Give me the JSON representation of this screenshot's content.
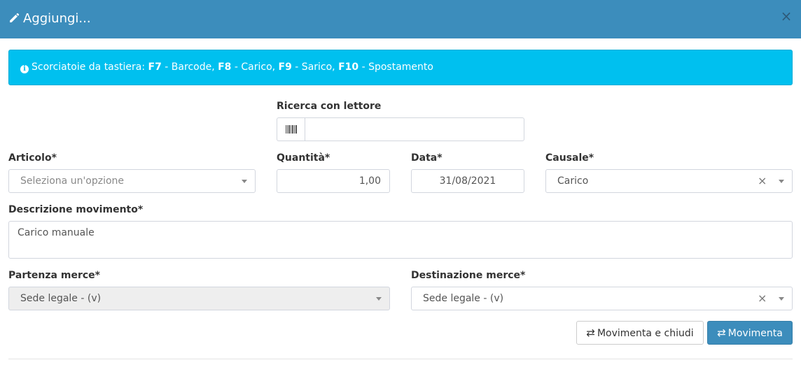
{
  "dialog": {
    "title": "Aggiungi...",
    "title_icon": "pencil-icon",
    "close_icon": "close-icon",
    "close_glyph": "×"
  },
  "alert": {
    "icon": "info-icon",
    "icon_glyph": "i",
    "prefix": "Scorciatoie da tastiera: ",
    "shortcuts": [
      {
        "key": "F7",
        "label": " - Barcode, "
      },
      {
        "key": "F8",
        "label": " - Carico, "
      },
      {
        "key": "F9",
        "label": " - Sarico, "
      },
      {
        "key": "F10",
        "label": " - Spostamento"
      }
    ]
  },
  "form": {
    "barcode": {
      "label": "Ricerca con lettore",
      "icon": "barcode-icon",
      "value": ""
    },
    "articolo": {
      "label": "Articolo*",
      "placeholder": "Seleziona un'opzione"
    },
    "quantita": {
      "label": "Quantità*",
      "value": "1,00"
    },
    "data": {
      "label": "Data*",
      "value": "31/08/2021"
    },
    "causale": {
      "label": "Causale*",
      "value": "Carico",
      "clear_glyph": "×"
    },
    "descrizione": {
      "label": "Descrizione movimento*",
      "value": "Carico manuale"
    },
    "partenza": {
      "label": "Partenza merce*",
      "value": "Sede legale - (v)"
    },
    "destinazione": {
      "label": "Destinazione merce*",
      "value": "Sede legale - (v)",
      "clear_glyph": "×"
    }
  },
  "buttons": {
    "icon": "exchange-icon",
    "icon_glyph": "⇄",
    "movimenta_chiudi": "Movimenta e chiudi",
    "movimenta": "Movimenta"
  },
  "colors": {
    "header": "#3c8dbc",
    "alert": "#00c0ef",
    "primary": "#3c8dbc"
  }
}
